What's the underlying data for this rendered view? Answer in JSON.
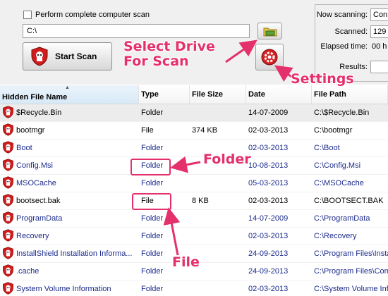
{
  "scan_options": {
    "complete_scan_label": "Perform complete computer scan",
    "drive_path": "C:\\",
    "start_scan_label": "Start Scan"
  },
  "status": {
    "now_scanning_label": "Now scanning:",
    "now_scanning_value": "Con",
    "scanned_label": "Scanned:",
    "scanned_value": "129",
    "elapsed_label": "Elapsed time:",
    "elapsed_value": "00 h",
    "results_label": "Results:",
    "results_value": ""
  },
  "table": {
    "headers": [
      "Hidden File Name",
      "Type",
      "File Size",
      "Date",
      "File Path"
    ],
    "rows": [
      {
        "name": "$Recycle.Bin",
        "type": "Folder",
        "size": "",
        "date": "14-07-2009",
        "path": "C:\\$Recycle.Bin",
        "color": "black"
      },
      {
        "name": "bootmgr",
        "type": "File",
        "size": "374 KB",
        "date": "02-03-2013",
        "path": "C:\\bootmgr",
        "color": "black"
      },
      {
        "name": "Boot",
        "type": "Folder",
        "size": "",
        "date": "02-03-2013",
        "path": "C:\\Boot",
        "color": "blue"
      },
      {
        "name": "Config.Msi",
        "type": "Folder",
        "size": "",
        "date": "10-08-2013",
        "path": "C:\\Config.Msi",
        "color": "blue"
      },
      {
        "name": "MSOCache",
        "type": "Folder",
        "size": "",
        "date": "05-03-2013",
        "path": "C:\\MSOCache",
        "color": "blue"
      },
      {
        "name": "bootsect.bak",
        "type": "File",
        "size": "8 KB",
        "date": "02-03-2013",
        "path": "C:\\BOOTSECT.BAK",
        "color": "black"
      },
      {
        "name": "ProgramData",
        "type": "Folder",
        "size": "",
        "date": "14-07-2009",
        "path": "C:\\ProgramData",
        "color": "blue"
      },
      {
        "name": "Recovery",
        "type": "Folder",
        "size": "",
        "date": "02-03-2013",
        "path": "C:\\Recovery",
        "color": "blue"
      },
      {
        "name": "InstallShield Installation Informa...",
        "type": "Folder",
        "size": "",
        "date": "24-09-2013",
        "path": "C:\\Program Files\\Insta",
        "color": "blue"
      },
      {
        "name": ".cache",
        "type": "Folder",
        "size": "",
        "date": "24-09-2013",
        "path": "C:\\Program Files\\Comr",
        "color": "blue"
      },
      {
        "name": "System Volume Information",
        "type": "Folder",
        "size": "",
        "date": "02-03-2013",
        "path": "C:\\System Volume Inform",
        "color": "blue"
      }
    ]
  },
  "annotations": {
    "select_drive": "Select Drive\nFor Scan",
    "settings": "Settings",
    "folder": "Folder",
    "file": "File"
  },
  "colors": {
    "annotation": "#e4306b",
    "folder_text": "#1c2c8c"
  }
}
